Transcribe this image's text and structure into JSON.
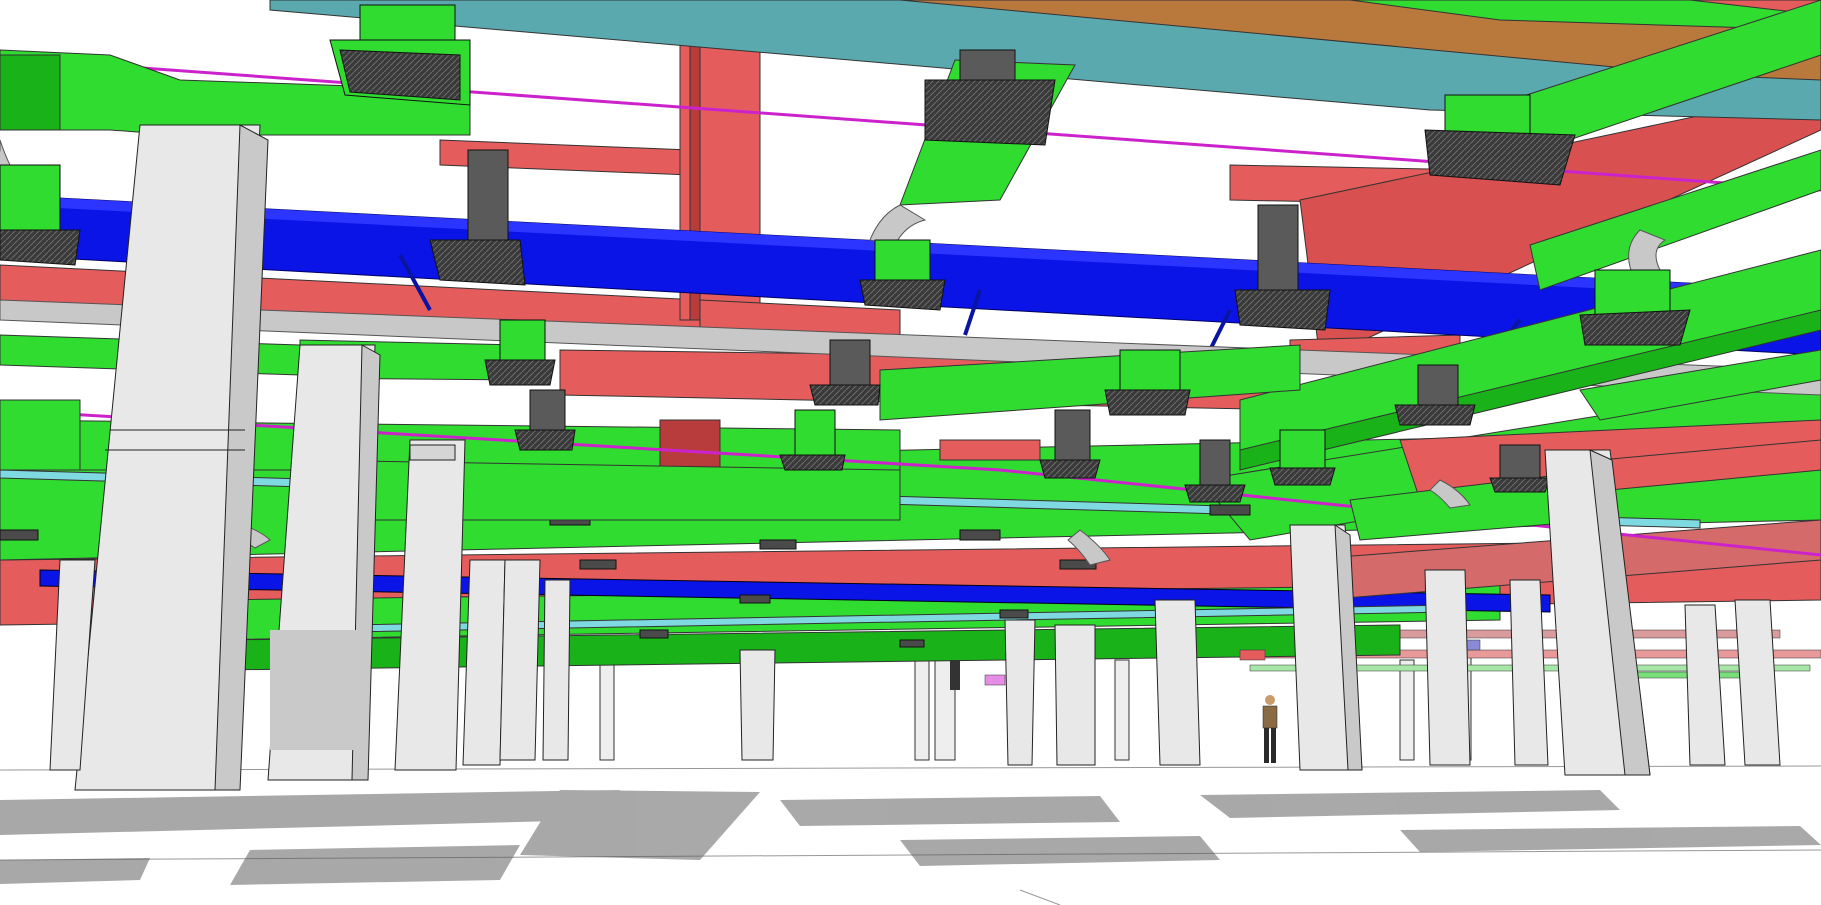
{
  "scene": {
    "subject": "bim-mep-coordination-model",
    "colors": {
      "supply_duct": "#2fdc2f",
      "supply_duct_shade": "#19b319",
      "return_duct": "#e55c5c",
      "return_duct_shade": "#b93c3c",
      "chilled_water_pipe": "#0a14e6",
      "teal_tray": "#5aa9ae",
      "orange_tray": "#b9783c",
      "magenta_line": "#cc22cc",
      "flex_duct": "#c8c8c8",
      "diffuser": "#4a4a4a",
      "column": "#e8e8e8",
      "column_shade": "#c9c9c9",
      "floor_shadow": "#9a9a9a"
    }
  }
}
